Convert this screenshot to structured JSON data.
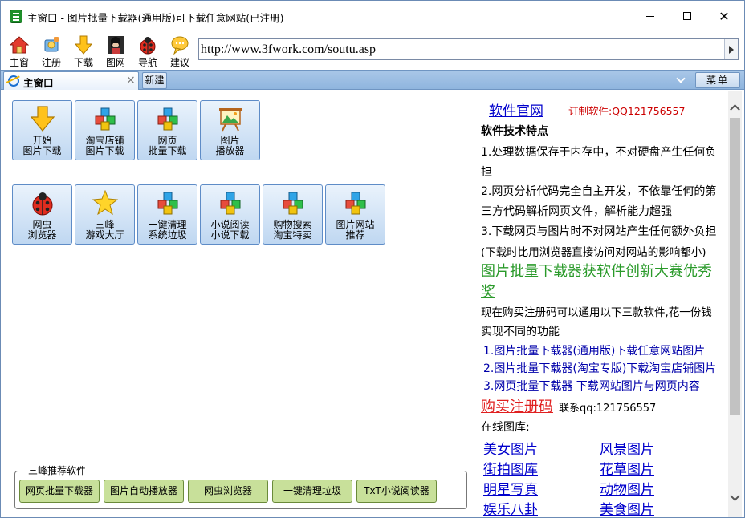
{
  "window": {
    "title": "主窗口 - 图片批量下载器(通用版)可下载任意网站(已注册)"
  },
  "toolbar": {
    "buttons": [
      {
        "label": "主窗",
        "icon": "home-icon"
      },
      {
        "label": "注册",
        "icon": "register-icon"
      },
      {
        "label": "下载",
        "icon": "download-arrow-icon"
      },
      {
        "label": "图网",
        "icon": "picture-site-icon"
      },
      {
        "label": "导航",
        "icon": "ladybug-icon"
      },
      {
        "label": "建议",
        "icon": "speech-bubble-icon"
      }
    ],
    "url": "http://www.3fwork.com/soutu.asp"
  },
  "tabs": {
    "active_label": "主窗口",
    "new_label": "新建",
    "menu_label": "菜单"
  },
  "tiles_row1": [
    {
      "l1": "开始",
      "l2": "图片下载",
      "icon": "download-arrow-icon"
    },
    {
      "l1": "淘宝店铺",
      "l2": "图片下载",
      "icon": "cubes-icon"
    },
    {
      "l1": "网页",
      "l2": "批量下载",
      "icon": "cubes-icon"
    },
    {
      "l1": "图片",
      "l2": "播放器",
      "icon": "easel-icon"
    }
  ],
  "tiles_row2": [
    {
      "l1": "网虫",
      "l2": "浏览器",
      "icon": "ladybug-icon"
    },
    {
      "l1": "三峰",
      "l2": "游戏大厅",
      "icon": "star-icon"
    },
    {
      "l1": "一键清理",
      "l2": "系统垃圾",
      "icon": "cubes-icon"
    },
    {
      "l1": "小说阅读",
      "l2": "小说下载",
      "icon": "cubes-icon"
    },
    {
      "l1": "购物搜索",
      "l2": "淘宝特卖",
      "icon": "cubes-icon"
    },
    {
      "l1": "图片网站",
      "l2": "推荐",
      "icon": "cubes-icon"
    }
  ],
  "recommend": {
    "legend": "三峰推荐软件",
    "buttons": [
      "网页批量下载器",
      "图片自动播放器",
      "网虫浏览器",
      "一键清理垃圾",
      "TxT小说阅读器"
    ]
  },
  "panel": {
    "official_site": "软件官网",
    "custom_software": "订制软件:QQ121756557",
    "features_title": "软件技术特点",
    "feature1a": "1.处理数据保存于内存中，不对硬盘产生任何负",
    "feature1b": "担",
    "feature2a": "2.网页分析代码完全自主开发，不依靠任何的第",
    "feature2b": "三方代码解析网页文件，解析能力超强",
    "feature3a": "3.下载网页与图片时不对网站产生任何额外负担",
    "feature3b": "(下载时比用浏览器直接访问对网站的影响都小)",
    "award_a": "图片批量下载器获软件创新大赛优秀",
    "award_b": "奖",
    "offer_a": "现在购买注册码可以通用以下三款软件,花一份钱",
    "offer_b": "实现不同的功能",
    "product1": "1.图片批量下载器(通用版)下载任意网站图片",
    "product2": "2.图片批量下载器(淘宝专版)下载淘宝店铺图片",
    "product3": "3.网页批量下载器 下载网站图片与网页内容",
    "buy_code": "购买注册码",
    "contact": "联系qq:121756557",
    "gallery_title": "在线图库:",
    "gallery": [
      "美女图片",
      "风景图片",
      "街拍图库",
      "花草图片",
      "明星写真",
      "动物图片",
      "娱乐八卦",
      "美食图片"
    ]
  },
  "colors": {
    "tab_strip": "#9dbde3",
    "tile_border": "#5e8cc7",
    "rec_button": "#c8e09a",
    "link_blue": "#0000cc",
    "award_green": "#2a9a2a",
    "buy_red": "#e02020",
    "custom_red": "#cc0000"
  }
}
